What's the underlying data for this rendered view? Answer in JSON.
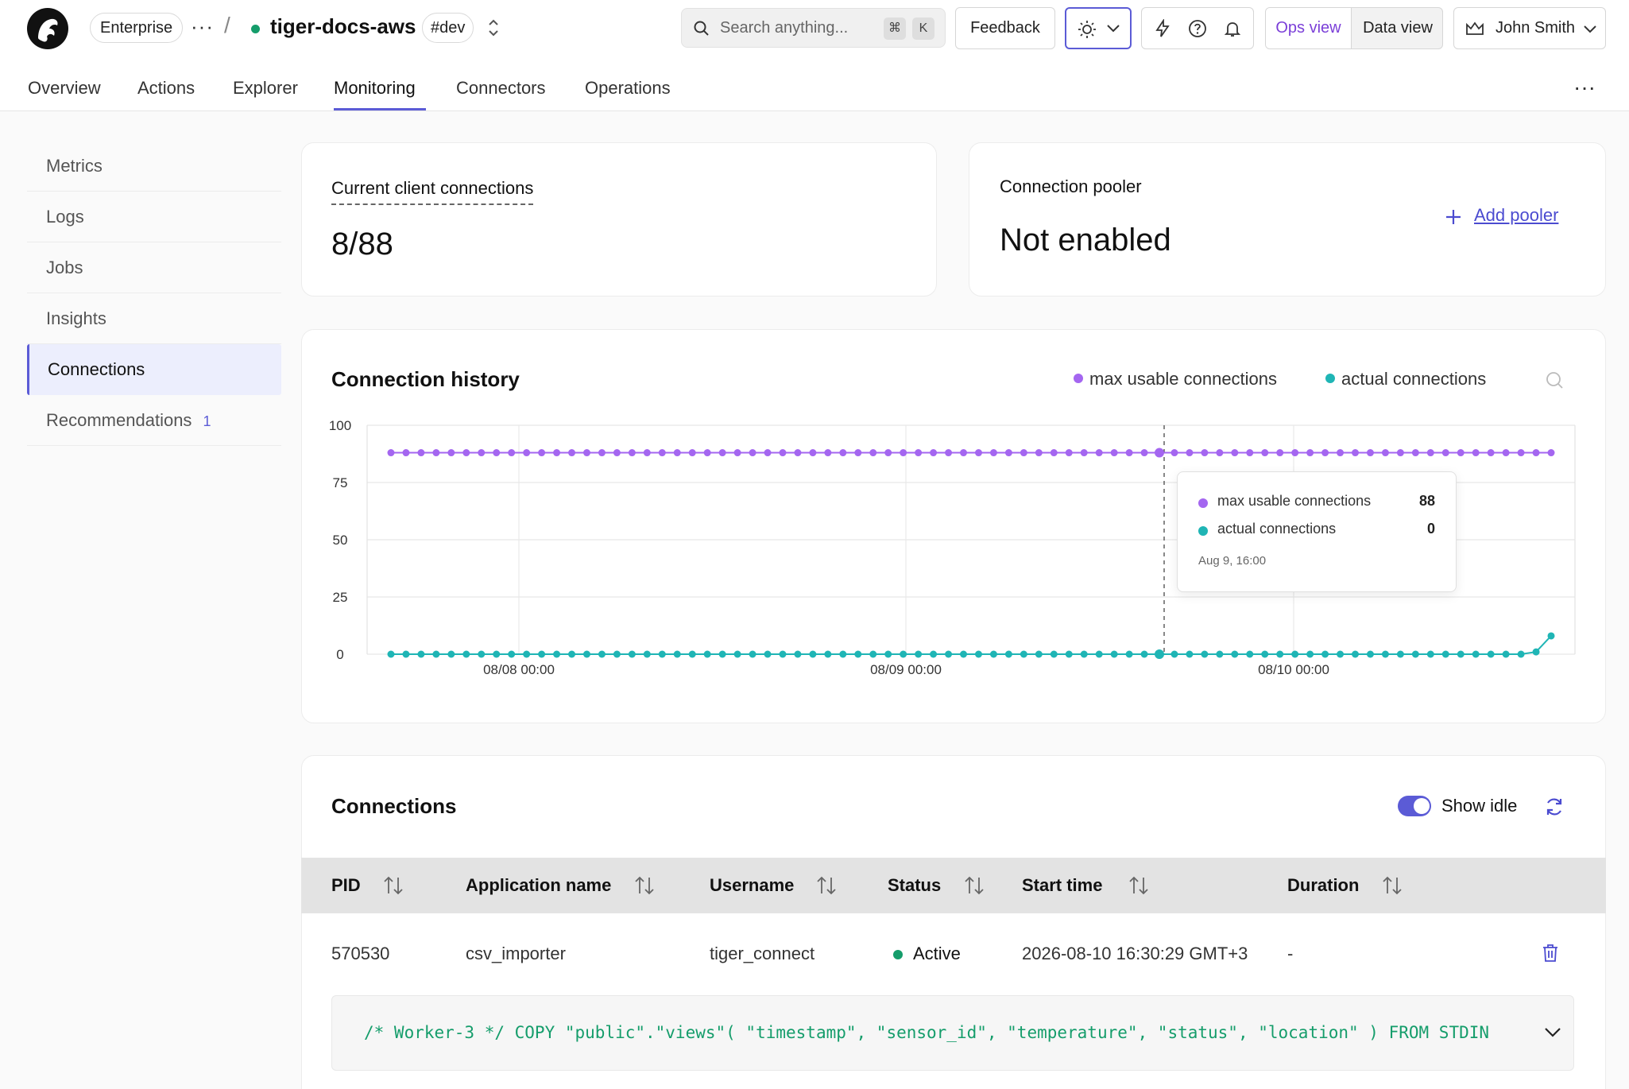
{
  "header": {
    "org_label": "Enterprise",
    "service_name": "tiger-docs-aws",
    "env_tag": "#dev",
    "search_placeholder": "Search anything...",
    "search_shortcut": [
      "⌘",
      "K"
    ],
    "feedback_label": "Feedback",
    "view_toggle": {
      "ops_label": "Ops view",
      "data_label": "Data view",
      "selected": "Ops view"
    },
    "user_name": "John Smith"
  },
  "tabs": [
    "Overview",
    "Actions",
    "Explorer",
    "Monitoring",
    "Connectors",
    "Operations"
  ],
  "active_tab": "Monitoring",
  "sidebar": {
    "items": [
      {
        "label": "Metrics"
      },
      {
        "label": "Logs"
      },
      {
        "label": "Jobs"
      },
      {
        "label": "Insights"
      },
      {
        "label": "Connections"
      },
      {
        "label": "Recommendations",
        "badge": "1"
      }
    ],
    "active": "Connections"
  },
  "client_connections": {
    "label": "Current client connections",
    "value": "8/88"
  },
  "pooler": {
    "label": "Connection pooler",
    "value": "Not enabled",
    "action_label": "Add pooler"
  },
  "chart_data": {
    "type": "line",
    "title": "Connection history",
    "x_tick_labels": [
      "08/08 00:00",
      "08/09 00:00",
      "08/10 00:00"
    ],
    "y_ticks": [
      "0",
      "25",
      "50",
      "75",
      "100"
    ],
    "ylim": [
      0,
      100
    ],
    "grid": true,
    "legend_position": "top-right",
    "series": [
      {
        "name": "max usable connections",
        "color": "#a466f0",
        "values": [
          88,
          88,
          88,
          88,
          88,
          88,
          88,
          88,
          88,
          88,
          88,
          88,
          88,
          88,
          88,
          88,
          88,
          88,
          88,
          88,
          88,
          88,
          88,
          88,
          88,
          88,
          88,
          88,
          88,
          88,
          88,
          88,
          88,
          88,
          88,
          88,
          88,
          88,
          88,
          88,
          88,
          88,
          88,
          88,
          88,
          88,
          88,
          88,
          88,
          88,
          88,
          88,
          88,
          88,
          88,
          88,
          88,
          88,
          88,
          88,
          88,
          88,
          88,
          88,
          88,
          88,
          88,
          88,
          88,
          88,
          88,
          88,
          88,
          88,
          88,
          88,
          88,
          88
        ]
      },
      {
        "name": "actual connections",
        "color": "#1fb5b5",
        "values": [
          0,
          0,
          0,
          0,
          0,
          0,
          0,
          0,
          0,
          0,
          0,
          0,
          0,
          0,
          0,
          0,
          0,
          0,
          0,
          0,
          0,
          0,
          0,
          0,
          0,
          0,
          0,
          0,
          0,
          0,
          0,
          0,
          0,
          0,
          0,
          0,
          0,
          0,
          0,
          0,
          0,
          0,
          0,
          0,
          0,
          0,
          0,
          0,
          0,
          0,
          0,
          0,
          0,
          0,
          0,
          0,
          0,
          0,
          0,
          0,
          0,
          0,
          0,
          0,
          0,
          0,
          0,
          0,
          0,
          0,
          0,
          0,
          0,
          0,
          0,
          0,
          1,
          8
        ]
      }
    ],
    "tooltip": {
      "time": "Aug 9, 16:00",
      "rows": [
        {
          "name": "max usable connections",
          "value": "88"
        },
        {
          "name": "actual connections",
          "value": "0"
        }
      ]
    }
  },
  "connections": {
    "title": "Connections",
    "show_idle_label": "Show idle",
    "show_idle_enabled": true,
    "columns": [
      "PID",
      "Application name",
      "Username",
      "Status",
      "Start time",
      "Duration"
    ],
    "rows": [
      {
        "pid": "570530",
        "application_name": "csv_importer",
        "username": "tiger_connect",
        "status": "Active",
        "start_time": "2026-08-10 16:30:29 GMT+3",
        "duration": "-",
        "query": "/* Worker-3 */ COPY \"public\".\"views\"( \"timestamp\", \"sensor_id\", \"temperature\", \"status\", \"location\" ) FROM STDIN"
      }
    ]
  }
}
